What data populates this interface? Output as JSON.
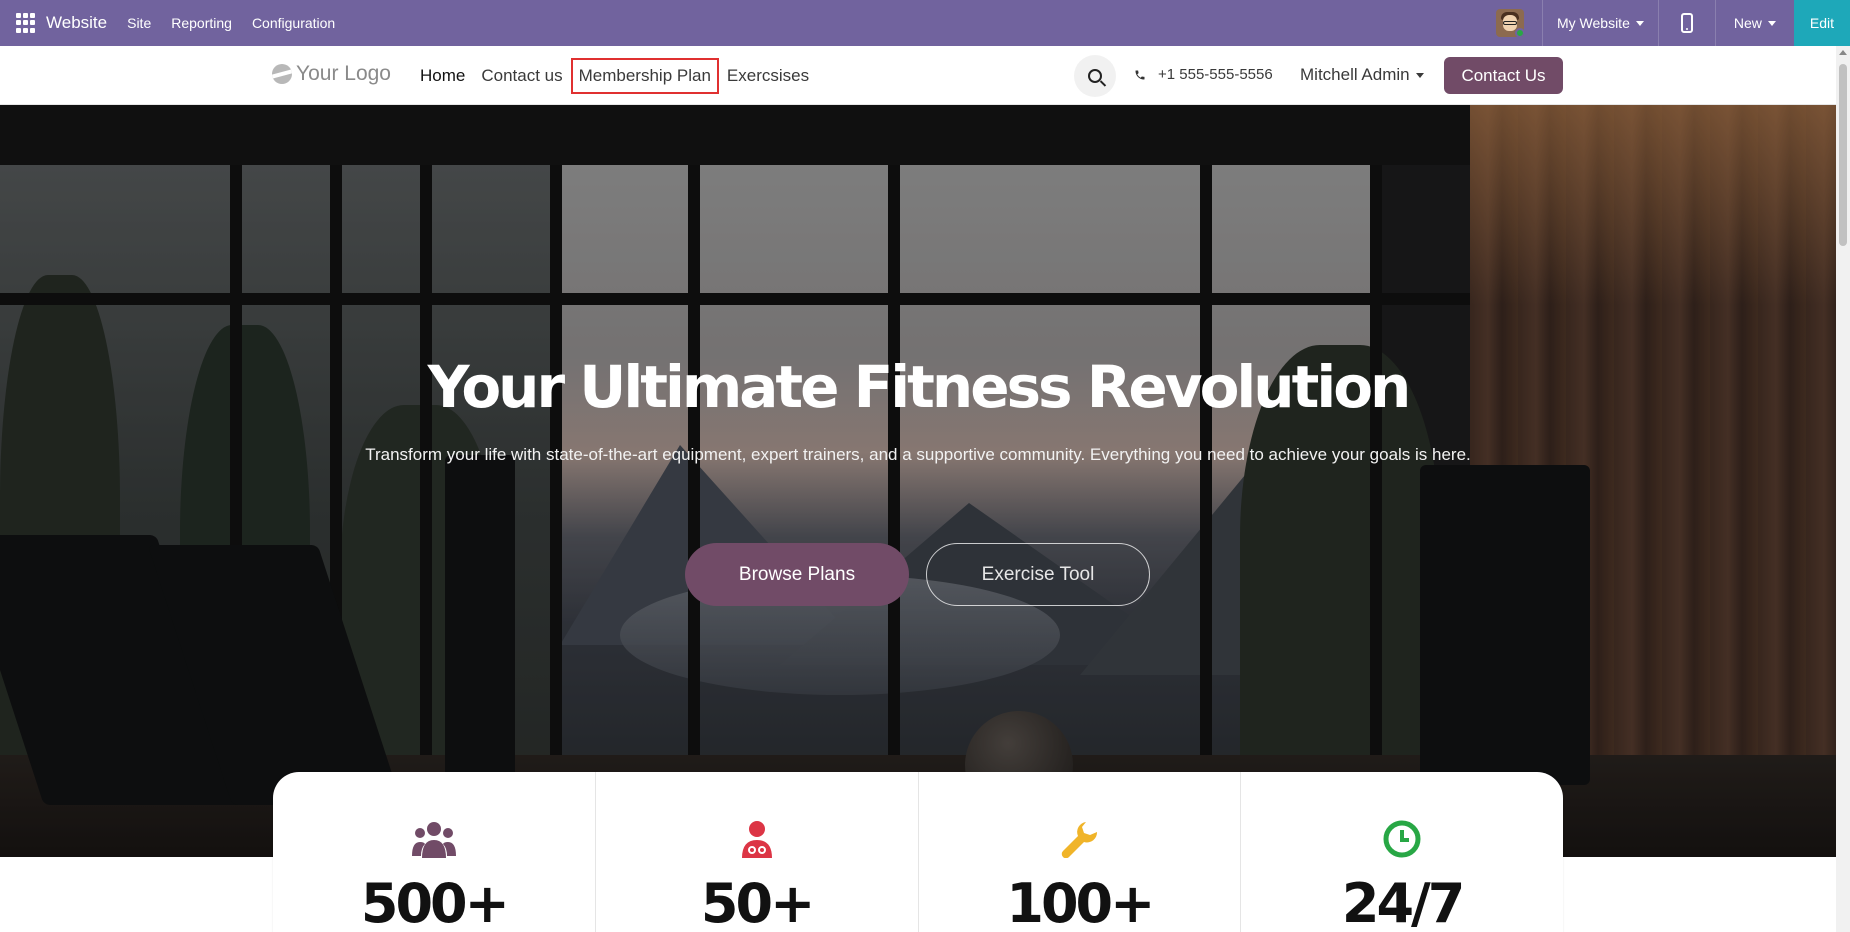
{
  "admin_bar": {
    "brand": "Website",
    "menus": [
      "Site",
      "Reporting",
      "Configuration"
    ],
    "website_selector": "My Website",
    "new_label": "New",
    "edit_label": "Edit",
    "bg_color": "#71639e"
  },
  "header": {
    "logo_text": "Your Logo",
    "nav": [
      "Home",
      "Contact us",
      "Membership Plan",
      "Exercsises"
    ],
    "phone": "+1 555-555-5556",
    "user": "Mitchell Admin",
    "cta": "Contact Us",
    "accent_color": "#714b67"
  },
  "hero": {
    "title": "Your Ultimate Fitness Revolution",
    "subtitle": "Transform your life with state-of-the-art equipment, expert trainers, and a supportive community. Everything you need to achieve your goals is here.",
    "primary_button": "Browse Plans",
    "secondary_button": "Exercise Tool"
  },
  "stats": [
    {
      "icon": "users-icon",
      "value": "500+",
      "color": "#714b67"
    },
    {
      "icon": "doctor-icon",
      "value": "50+",
      "color": "#dc3545"
    },
    {
      "icon": "wrench-icon",
      "value": "100+",
      "color": "#f0b429"
    },
    {
      "icon": "clock-icon",
      "value": "24/7",
      "color": "#28a745"
    }
  ]
}
